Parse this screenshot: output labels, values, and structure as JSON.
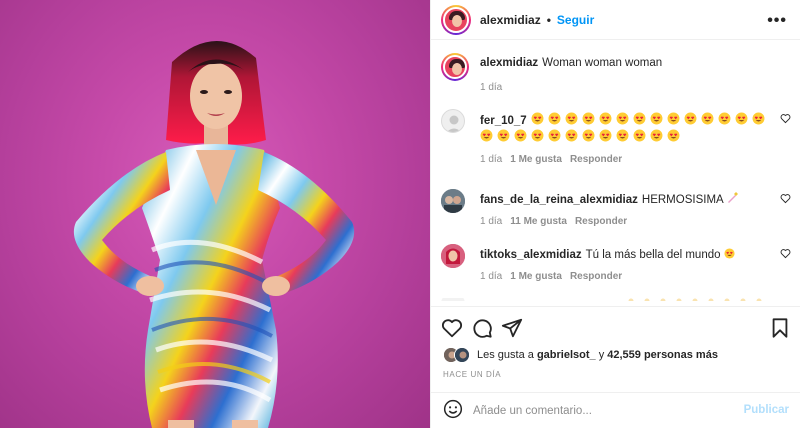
{
  "post": {
    "author": "alexmidiaz",
    "follow_label": "Seguir",
    "separator": "•",
    "more_label": "•••",
    "caption": "Woman woman woman",
    "caption_time": "1 día"
  },
  "comments": [
    {
      "user": "fer_10_7",
      "text": "",
      "emoji_count": 26,
      "time": "1 día",
      "likes": "1 Me gusta",
      "reply": "Responder"
    },
    {
      "user": "fans_de_la_reina_alexmidiaz",
      "text": "HERMOSISIMA",
      "trailing_emoji": "nail-polish-emoji",
      "time": "1 día",
      "likes": "11 Me gusta",
      "reply": "Responder"
    },
    {
      "user": "tiktoks_alexmidiaz",
      "text": "Tú la más bella del mundo",
      "trailing_emoji": "heart-eyes-emoji",
      "time": "1 día",
      "likes": "1 Me gusta",
      "reply": "Responder"
    }
  ],
  "likes": {
    "prefix": "Les gusta a",
    "user": "gabrielsot_",
    "connector": "y",
    "count": "42,559 personas más"
  },
  "time_ago": "HACE UN DÍA",
  "composer": {
    "placeholder": "Añade un comentario...",
    "publish_label": "Publicar"
  },
  "colors": {
    "accent": "#0095f6",
    "publish_disabled": "#b2dffc",
    "muted": "#8e8e8e",
    "background_photo": "#c64aa9"
  },
  "icons": [
    "heart-icon",
    "comment-icon",
    "share-icon",
    "bookmark-icon",
    "emoji-icon",
    "more-icon"
  ]
}
